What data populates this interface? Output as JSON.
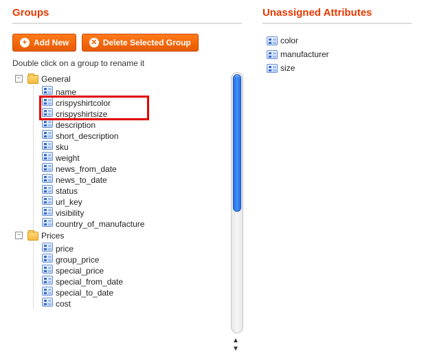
{
  "left": {
    "title": "Groups",
    "buttons": {
      "add": "Add New",
      "delete": "Delete Selected Group"
    },
    "hint": "Double click on a group to rename it"
  },
  "right": {
    "title": "Unassigned Attributes",
    "items": [
      "color",
      "manufacturer",
      "size"
    ]
  },
  "tree": {
    "groups": [
      {
        "name": "General",
        "attrs": [
          "name",
          "crispyshirtcolor",
          "crispyshirtsize",
          "description",
          "short_description",
          "sku",
          "weight",
          "news_from_date",
          "news_to_date",
          "status",
          "url_key",
          "visibility",
          "country_of_manufacture"
        ]
      },
      {
        "name": "Prices",
        "attrs": [
          "price",
          "group_price",
          "special_price",
          "special_from_date",
          "special_to_date",
          "cost"
        ]
      }
    ]
  },
  "highlight": {
    "group": 0,
    "start": 1,
    "end": 2
  }
}
